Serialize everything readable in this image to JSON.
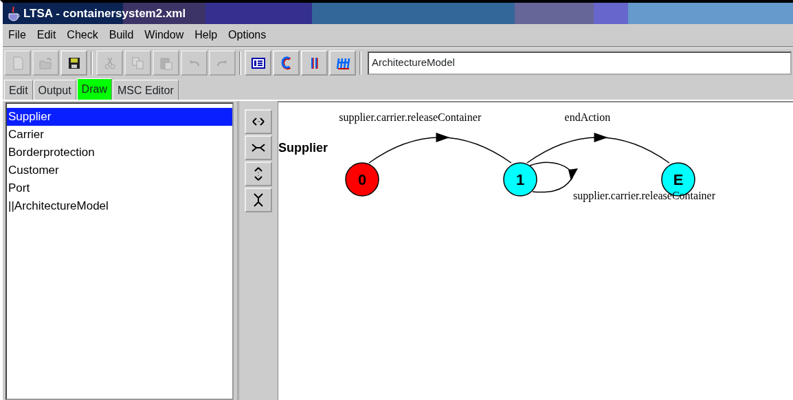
{
  "window": {
    "title": "LTSA - containersystem2.xml"
  },
  "menu": [
    "File",
    "Edit",
    "Check",
    "Build",
    "Window",
    "Help",
    "Options"
  ],
  "toolbar": [
    {
      "kind": "new",
      "disabled": true
    },
    {
      "kind": "open",
      "disabled": true
    },
    {
      "kind": "save",
      "disabled": false
    },
    {
      "kind": "cut",
      "disabled": true
    },
    {
      "kind": "copy",
      "disabled": true
    },
    {
      "kind": "paste",
      "disabled": true
    },
    {
      "kind": "undo",
      "disabled": true
    },
    {
      "kind": "redo",
      "disabled": true
    },
    {
      "kind": "list",
      "disabled": false
    },
    {
      "kind": "compile",
      "disabled": false
    },
    {
      "kind": "compose",
      "disabled": false
    },
    {
      "kind": "minimise",
      "disabled": false
    }
  ],
  "target": {
    "value": "ArchitectureModel"
  },
  "tabs": [
    {
      "label": "Edit",
      "selected": false
    },
    {
      "label": "Output",
      "selected": false
    },
    {
      "label": "Draw",
      "selected": true
    },
    {
      "label": "MSC Editor",
      "selected": false
    }
  ],
  "processes": [
    {
      "label": "Supplier",
      "selected": true
    },
    {
      "label": "Carrier",
      "selected": false
    },
    {
      "label": "Borderprotection",
      "selected": false
    },
    {
      "label": "Customer",
      "selected": false
    },
    {
      "label": "Port",
      "selected": false
    },
    {
      "label": "||ArchitectureModel",
      "selected": false
    }
  ],
  "zoom_tools": [
    {
      "kind": "stretch-h"
    },
    {
      "kind": "shrink-h"
    },
    {
      "kind": "stretch-v"
    },
    {
      "kind": "shrink-v"
    }
  ],
  "diagram": {
    "title": "Supplier",
    "states": [
      {
        "label": "0",
        "color": "#ff0000"
      },
      {
        "label": "1",
        "color": "#00ffff"
      },
      {
        "label": "E",
        "color": "#00ffff"
      }
    ],
    "transitions": [
      {
        "kind": "arc",
        "label": "supplier.carrier.releaseContainer"
      },
      {
        "kind": "arc",
        "label": "endAction"
      },
      {
        "kind": "loop",
        "label": "supplier.carrier.releaseContainer"
      }
    ]
  }
}
